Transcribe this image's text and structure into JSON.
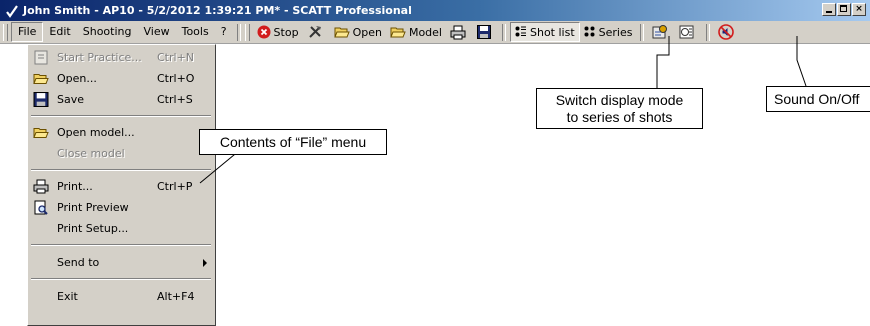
{
  "window": {
    "title": "John Smith - AP10 - 5/2/2012 1:39:21 PM* - SCATT Professional",
    "app_icon": "checkmark-pen-icon",
    "controls": [
      "minimize-icon",
      "maximize-icon",
      "close-icon"
    ]
  },
  "menubar": {
    "menus": [
      "File",
      "Edit",
      "Shooting",
      "View",
      "Tools",
      "?"
    ],
    "active_menu": "File"
  },
  "toolbar": {
    "stop_label": "Stop",
    "tools_icon": "hammer-pick-icon",
    "open_label": "Open",
    "model_label": "Model",
    "print_icon": "printer-icon",
    "save_icon": "floppy-disk-icon",
    "shot_list_label": "Shot list",
    "series_label": "Series",
    "icon_a": "settings-card-icon",
    "icon_b": "target-icon",
    "sound_icon": "speaker-icon"
  },
  "file_menu": {
    "items": [
      {
        "label": "Start Practice...",
        "shortcut": "Ctrl+N",
        "disabled": true,
        "icon": "start-practice-icon"
      },
      {
        "label": "Open...",
        "shortcut": "Ctrl+O",
        "disabled": false,
        "icon": "folder-open-icon"
      },
      {
        "label": "Save",
        "shortcut": "Ctrl+S",
        "disabled": false,
        "icon": "floppy-disk-icon"
      },
      {
        "label": "Open model...",
        "shortcut": "",
        "disabled": false,
        "icon": "folder-open-icon"
      },
      {
        "label": "Close model",
        "shortcut": "",
        "disabled": true,
        "icon": ""
      },
      {
        "label": "Print...",
        "shortcut": "Ctrl+P",
        "disabled": false,
        "icon": "printer-icon"
      },
      {
        "label": "Print Preview",
        "shortcut": "",
        "disabled": false,
        "icon": "print-preview-icon"
      },
      {
        "label": "Print Setup...",
        "shortcut": "",
        "disabled": false,
        "icon": ""
      },
      {
        "label": "Send to",
        "shortcut": "",
        "disabled": false,
        "icon": "",
        "submenu": true
      },
      {
        "label": "Exit",
        "shortcut": "Alt+F4",
        "disabled": false,
        "icon": ""
      }
    ]
  },
  "callouts": {
    "file_menu": "Contents of “File” menu",
    "series_line1": "Switch display mode",
    "series_line2": "to series of shots",
    "sound": "Sound On/Off"
  }
}
